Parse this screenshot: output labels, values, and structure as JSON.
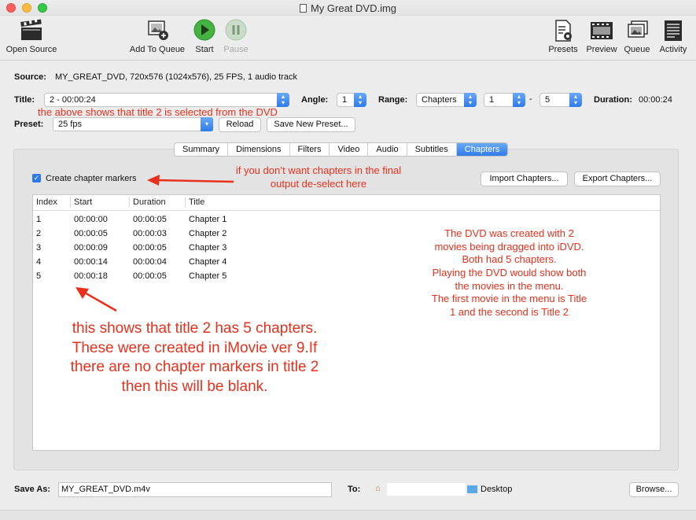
{
  "window": {
    "title": "My Great DVD.img"
  },
  "toolbar": {
    "open_source": "Open Source",
    "add_to_queue": "Add To Queue",
    "start": "Start",
    "pause": "Pause",
    "presets": "Presets",
    "preview": "Preview",
    "queue": "Queue",
    "activity": "Activity"
  },
  "source": {
    "label": "Source:",
    "value": "MY_GREAT_DVD, 720x576 (1024x576), 25 FPS, 1 audio track"
  },
  "title_row": {
    "label": "Title:",
    "value": "2 - 00:00:24",
    "angle_label": "Angle:",
    "angle_value": "1",
    "range_label": "Range:",
    "range_type": "Chapters",
    "range_from": "1",
    "range_sep": "-",
    "range_to": "5",
    "duration_label": "Duration:",
    "duration_value": "00:00:24"
  },
  "preset_row": {
    "label": "Preset:",
    "value": "25 fps",
    "reload": "Reload",
    "save_new": "Save New Preset..."
  },
  "tabs": [
    "Summary",
    "Dimensions",
    "Filters",
    "Video",
    "Audio",
    "Subtitles",
    "Chapters"
  ],
  "chapters": {
    "create_markers": "Create chapter markers",
    "import": "Import Chapters...",
    "export": "Export Chapters...",
    "columns": [
      "Index",
      "Start",
      "Duration",
      "Title"
    ],
    "rows": [
      [
        "1",
        "00:00:00",
        "00:00:05",
        "Chapter 1"
      ],
      [
        "2",
        "00:00:05",
        "00:00:03",
        "Chapter 2"
      ],
      [
        "3",
        "00:00:09",
        "00:00:05",
        "Chapter 3"
      ],
      [
        "4",
        "00:00:14",
        "00:00:04",
        "Chapter 4"
      ],
      [
        "5",
        "00:00:18",
        "00:00:05",
        "Chapter 5"
      ]
    ]
  },
  "save": {
    "label": "Save As:",
    "value": "MY_GREAT_DVD.m4v",
    "to_label": "To:",
    "destination": "Desktop",
    "browse": "Browse..."
  },
  "annotations": {
    "title_note": "the above shows that title 2 is selected from the DVD",
    "chapters_note_1": "if you don’t want chapters in the  final",
    "chapters_note_2": "output de-select here",
    "dvd_note": [
      "The DVD was created  with 2",
      "movies being dragged into iDVD.",
      "Both had 5 chapters.",
      "Playing the DVD would show both",
      "the movies in the menu.",
      "The first movie in the menu is Title",
      "1 and the second is Title 2"
    ],
    "table_note": [
      "this shows that title 2 has 5 chapters.",
      "These were created in iMovie ver 9.If",
      "there are no chapter markers in title 2",
      "then this will be blank."
    ]
  },
  "colors": {
    "accent": "#2f7ae8",
    "annotation": "#e8301c",
    "start_green": "#3dab3a"
  }
}
